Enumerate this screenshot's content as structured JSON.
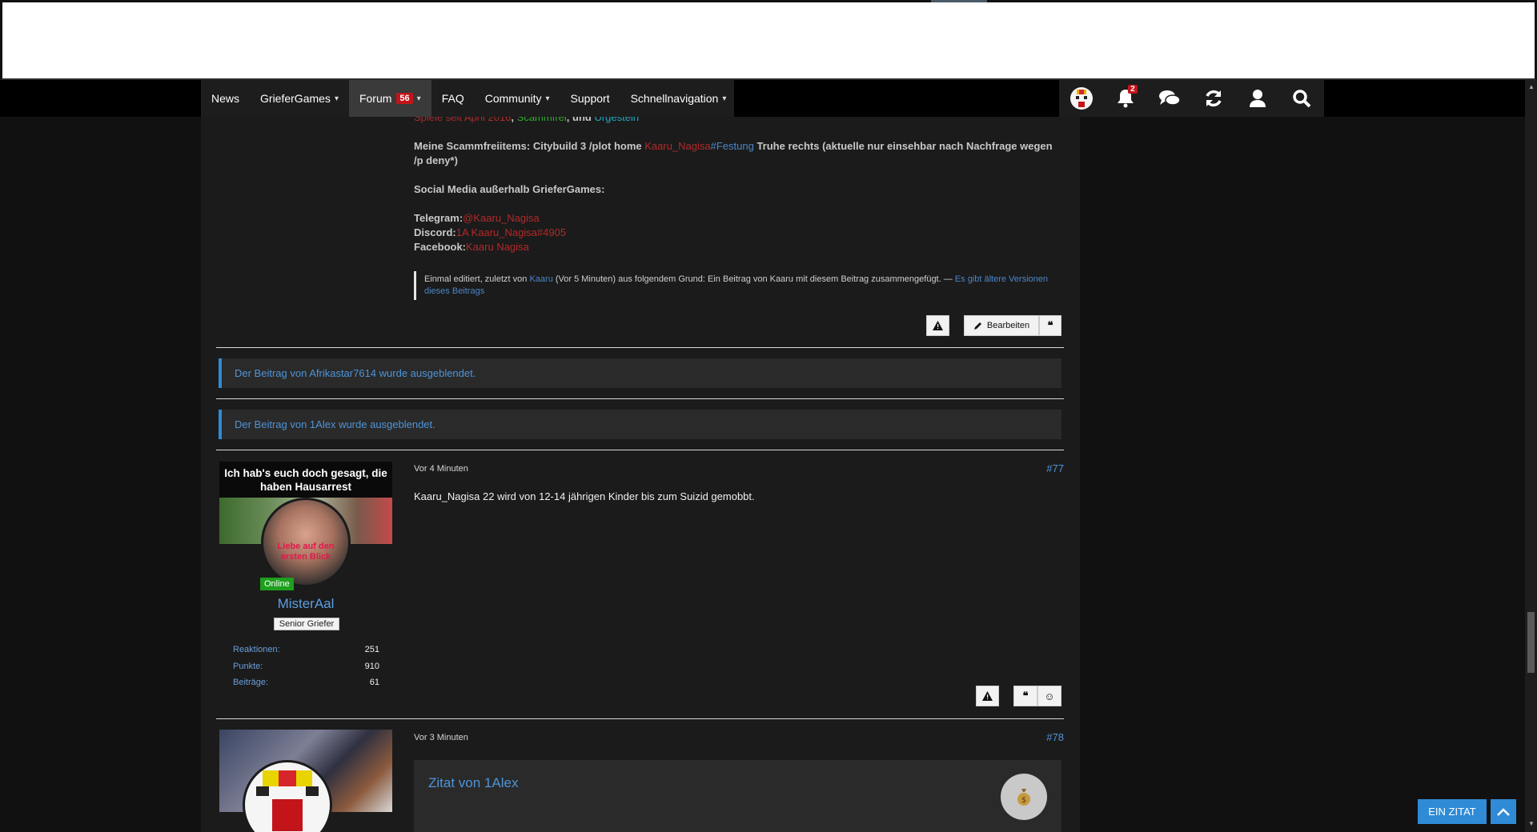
{
  "nav": {
    "items": [
      {
        "label": "News",
        "dropdown": false
      },
      {
        "label": "GrieferGames",
        "dropdown": true
      },
      {
        "label": "Forum",
        "badge": "56",
        "dropdown": true,
        "active": true
      },
      {
        "label": "FAQ",
        "dropdown": false
      },
      {
        "label": "Community",
        "dropdown": true
      },
      {
        "label": "Support",
        "dropdown": false
      },
      {
        "label": "Schnellnavigation",
        "dropdown": true
      }
    ],
    "notification_count": "2",
    "icons": [
      "user-avatar-icon",
      "bell-icon",
      "chat-icon",
      "refresh-icon",
      "user-icon",
      "search-icon"
    ]
  },
  "signature": {
    "top_line_parts": [
      "Spiele seit April 2016",
      ", ",
      "Scammfrei",
      ", und ",
      "Urgestein"
    ],
    "items_label": "Meine Scammfreiitems: Citybuild 3 /plot home ",
    "items_name": "Kaaru_Nagisa",
    "items_tag": "#Festung",
    "items_rest": " Truhe rechts (aktuelle nur einsehbar nach Nachfrage wegen /p deny*)",
    "social_heading": "Social Media außerhalb GrieferGames:",
    "telegram_label": "Telegram:",
    "telegram_value": "@Kaaru_Nagisa",
    "discord_label": "Discord:",
    "discord_value": "1A Kaaru_Nagisa#4905",
    "facebook_label": "Facebook:",
    "facebook_value": "Kaaru Nagisa"
  },
  "edit_note": {
    "prefix": "Einmal editiert, zuletzt von ",
    "user": "Kaaru",
    "rest": " (Vor 5 Minuten) aus folgendem Grund: Ein Beitrag von Kaaru mit diesem Beitrag zusammengefügt. — ",
    "link": "Es gibt ältere Versionen dieses Beitrags"
  },
  "actions": {
    "edit_label": "Bearbeiten"
  },
  "hidden_posts": [
    "Der Beitrag von Afrikastar7614 wurde ausgeblendet.",
    "Der Beitrag von 1Alex wurde ausgeblendet."
  ],
  "post77": {
    "banner_text": "Ich hab's euch doch gesagt, die haben Hausarrest",
    "avatar_text": "Liebe auf den ersten Blick",
    "online_label": "Online",
    "username": "MisterAal",
    "rank": "Senior Griefer",
    "stats": [
      {
        "label": "Reaktionen:",
        "value": "251"
      },
      {
        "label": "Punkte:",
        "value": "910"
      },
      {
        "label": "Beiträge:",
        "value": "61"
      }
    ],
    "time": "Vor 4 Minuten",
    "number": "#77",
    "body": "Kaaru_Nagisa 22 wird von 12-14 jährigen Kinder bis zum Suizid gemobbt."
  },
  "post78": {
    "time": "Vor 3 Minuten",
    "number": "#78",
    "quote_title": "Zitat von 1Alex"
  },
  "floating": {
    "zitat_label": "EIN ZITAT"
  }
}
